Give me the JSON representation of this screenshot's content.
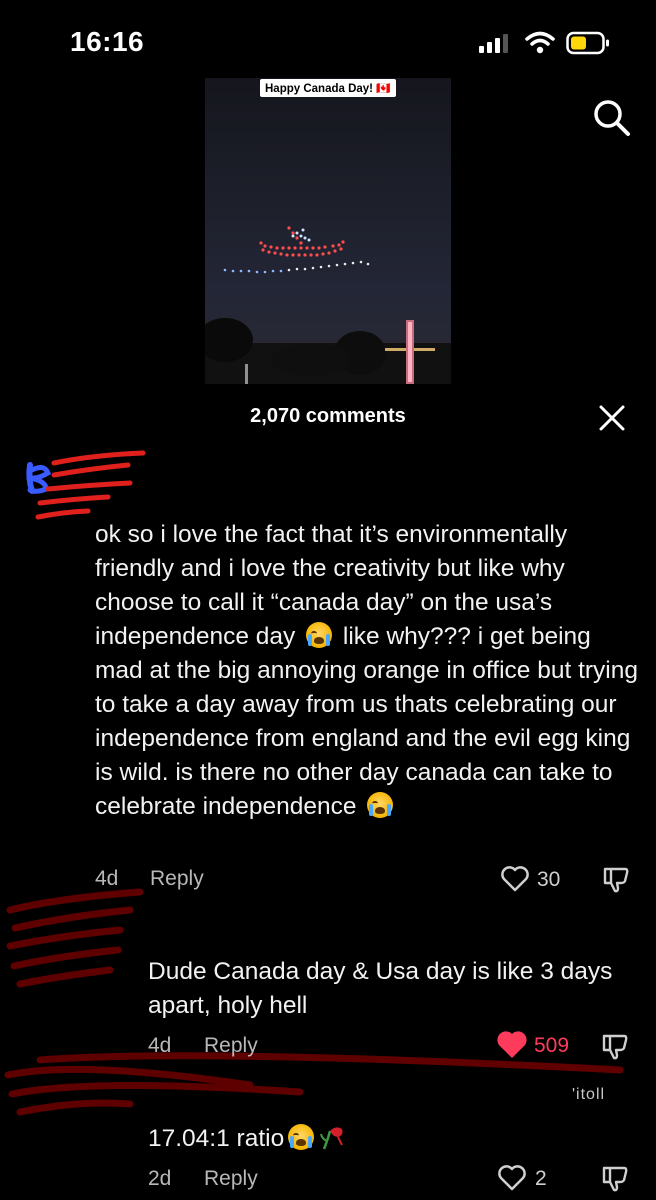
{
  "status_bar": {
    "time": "16:16"
  },
  "video": {
    "caption": "Happy Canada Day! 🇨🇦"
  },
  "comments_header": {
    "count_label": "2,070 comments"
  },
  "comments": [
    {
      "text_parts": [
        "ok so i love the fact that it’s environmentally friendly and i love the creativity but like why choose to call it “canada day” on the usa’s independence day ",
        " like why??? i get being mad at the big annoying orange in office but trying to take a day away from us thats celebrating our independence from england and the evil egg king is wild. is there no other day canada can take to celebrate independence "
      ],
      "age": "4d",
      "reply_label": "Reply",
      "likes": "30",
      "liked": false
    },
    {
      "text": "Dude Canada day & Usa day is like 3 days apart, holy hell",
      "age": "4d",
      "reply_label": "Reply",
      "likes": "509",
      "liked": true
    },
    {
      "text": "17.04:1 ratio",
      "age": "2d",
      "reply_label": "Reply",
      "likes": "2",
      "liked": false
    }
  ],
  "partial_username": "'itoll",
  "colors": {
    "like_red": "#ff3b5c",
    "background": "#000000"
  }
}
